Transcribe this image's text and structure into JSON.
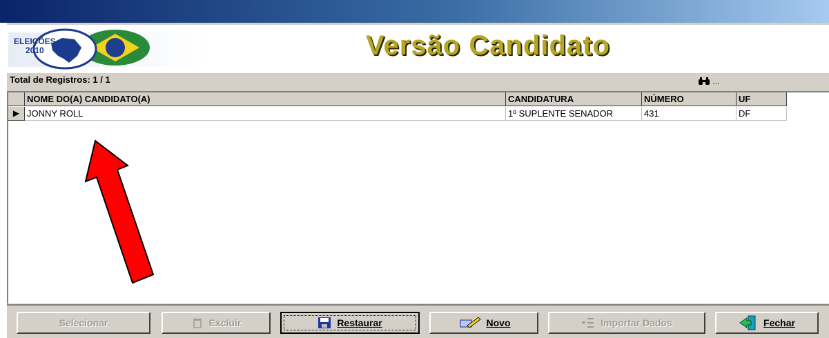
{
  "header": {
    "logo_line1": "ELEIÇÕES",
    "logo_line2": "2010",
    "title": "Versão Candidato"
  },
  "grid": {
    "total_label": "Total de Registros: 1 / 1",
    "columns": [
      "NOME DO(A) CANDIDATO(A)",
      "CANDIDATURA",
      "NÚMERO",
      "UF"
    ],
    "rows": [
      {
        "indicator": "▶",
        "nome": "JONNY ROLL",
        "candidatura": "1º SUPLENTE SENADOR",
        "numero": "431",
        "uf": "DF"
      }
    ]
  },
  "toolbar": {
    "selecionar": "Selecionar",
    "excluir": "Excluir",
    "restaurar": "Restaurar",
    "novo": "Novo",
    "importar": "Importar Dados",
    "fechar": "Fechar",
    "search_ellipsis": "..."
  },
  "colors": {
    "titlebar_start": "#0a246a",
    "accent_arrow": "#ff0000",
    "title_gold": "#b7a526"
  }
}
